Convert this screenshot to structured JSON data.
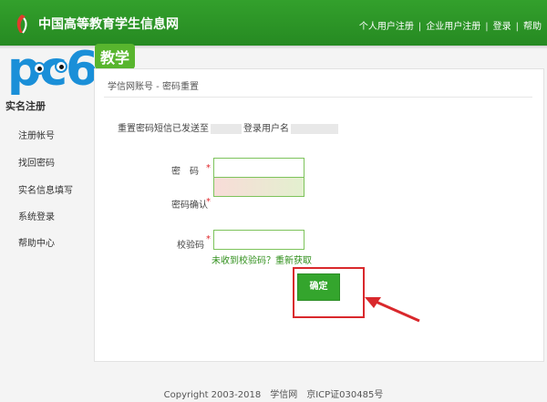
{
  "header": {
    "title": "中国高等教育学生信息网",
    "nav": [
      "个人用户注册",
      "企业用户注册",
      "登录",
      "帮助"
    ]
  },
  "watermark": {
    "text": "pc6",
    "badge": "教学"
  },
  "sidebar": {
    "heading": "实名注册",
    "items": [
      "注册帐号",
      "找回密码",
      "实名信息填写",
      "系统登录",
      "帮助中心"
    ]
  },
  "main": {
    "breadcrumb": "学信网账号 - 密码重置",
    "notice_prefix": "重置密码短信已发送至",
    "notice_middle": "登录用户名",
    "password_label": "密　码",
    "confirm_label": "密码确认",
    "captcha_label": "校验码",
    "required_mark": "*",
    "captcha_link": "未收到校验码？重新获取",
    "confirm_button": "确定"
  },
  "footer": {
    "copyright": "Copyright 2003-2018",
    "site": "学信网",
    "icp": "京ICP证030485号"
  },
  "colors": {
    "header_green": "#2e9a28",
    "button_green": "#34a52d",
    "highlight_red": "#d9282c",
    "watermark_blue": "#1a8fd8"
  }
}
